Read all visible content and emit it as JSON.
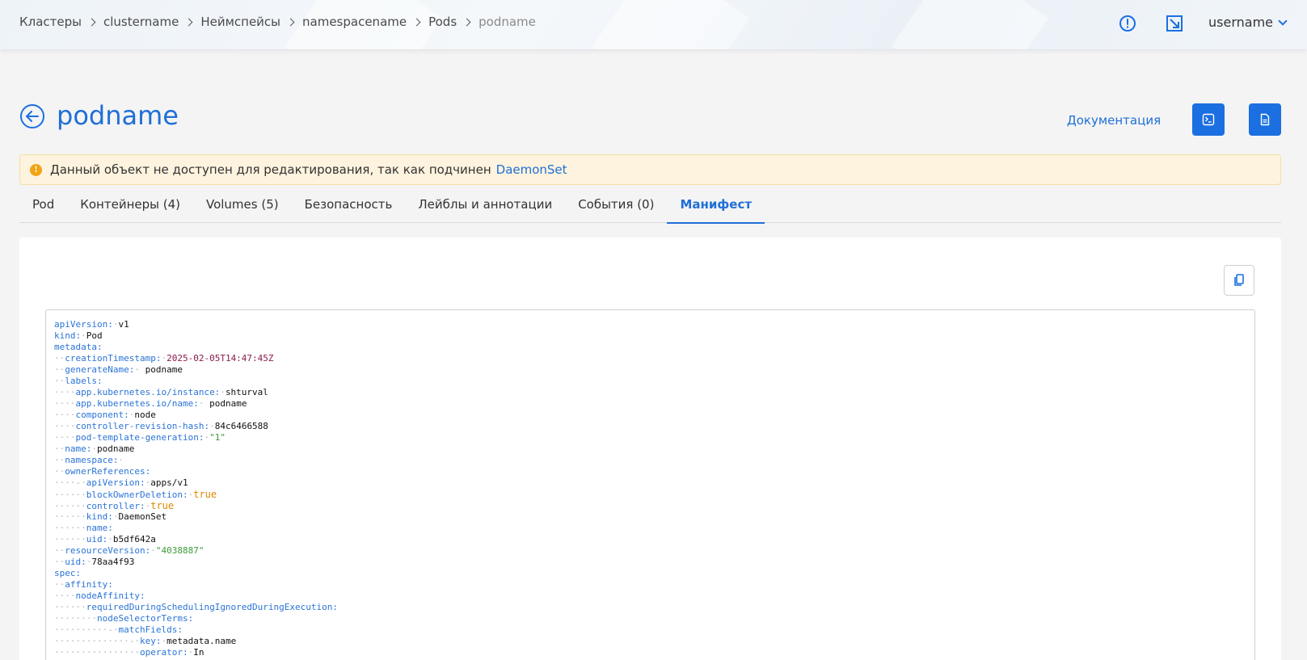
{
  "breadcrumb": [
    {
      "label": "Кластеры"
    },
    {
      "label": "clustername"
    },
    {
      "label": "Неймспейсы"
    },
    {
      "label": "namespacename"
    },
    {
      "label": "Pods"
    },
    {
      "label": "podname",
      "current": true
    }
  ],
  "header": {
    "user": "username"
  },
  "page": {
    "title": "podname",
    "doc_link": "Документация"
  },
  "alert": {
    "text": "Данный объект не доступен для редактирования, так как подчинен",
    "link": "DaemonSet"
  },
  "tabs": [
    {
      "label": "Pod"
    },
    {
      "label": "Контейнеры (4)"
    },
    {
      "label": "Volumes (5)"
    },
    {
      "label": "Безопасность"
    },
    {
      "label": "Лейблы и аннотации"
    },
    {
      "label": "События (0)"
    },
    {
      "label": "Манифест",
      "active": true
    }
  ],
  "manifest": [
    {
      "indent": "",
      "key": "apiVersion:",
      "sep": "·",
      "value": "v1"
    },
    {
      "indent": "",
      "key": "kind:",
      "sep": "·",
      "value": "Pod"
    },
    {
      "indent": "",
      "key": "metadata:",
      "sep": "",
      "value": ""
    },
    {
      "indent": "··",
      "key": "creationTimestamp:",
      "sep": "·",
      "value": "2025-02-05T14:47:45Z",
      "type": "date"
    },
    {
      "indent": "··",
      "key": "generateName:",
      "sep": "· ",
      "value": "podname"
    },
    {
      "indent": "··",
      "key": "labels:",
      "sep": "",
      "value": ""
    },
    {
      "indent": "····",
      "key": "app.kubernetes.io/instance:",
      "sep": "·",
      "value": "shturval"
    },
    {
      "indent": "····",
      "key": "app.kubernetes.io/name:",
      "sep": "· ",
      "value": "podname"
    },
    {
      "indent": "····",
      "key": "component:",
      "sep": "·",
      "value": "node"
    },
    {
      "indent": "····",
      "key": "controller-revision-hash:",
      "sep": "·",
      "value": "84c6466588"
    },
    {
      "indent": "····",
      "key": "pod-template-generation:",
      "sep": "·",
      "value": "\"1\"",
      "type": "str"
    },
    {
      "indent": "··",
      "key": "name:",
      "sep": "·",
      "value": "podname"
    },
    {
      "indent": "··",
      "key": "namespace:",
      "sep": "·",
      "value": ""
    },
    {
      "indent": "··",
      "key": "ownerReferences:",
      "sep": "",
      "value": ""
    },
    {
      "indent": "····-·",
      "key": "apiVersion:",
      "sep": "·",
      "value": "apps/v1"
    },
    {
      "indent": "······",
      "key": "blockOwnerDeletion:",
      "sep": "·",
      "value": "true",
      "type": "bool"
    },
    {
      "indent": "······",
      "key": "controller:",
      "sep": "·",
      "value": "true",
      "type": "bool"
    },
    {
      "indent": "······",
      "key": "kind:",
      "sep": "·",
      "value": "DaemonSet"
    },
    {
      "indent": "······",
      "key": "name:",
      "sep": "",
      "value": ""
    },
    {
      "indent": "······",
      "key": "uid:",
      "sep": "·",
      "value": "b5df642a"
    },
    {
      "indent": "··",
      "key": "resourceVersion:",
      "sep": "·",
      "value": "\"4038887\"",
      "type": "str"
    },
    {
      "indent": "··",
      "key": "uid:",
      "sep": "·",
      "value": "78aa4f93"
    },
    {
      "indent": "",
      "key": "spec:",
      "sep": "",
      "value": ""
    },
    {
      "indent": "··",
      "key": "affinity:",
      "sep": "",
      "value": ""
    },
    {
      "indent": "····",
      "key": "nodeAffinity:",
      "sep": "",
      "value": ""
    },
    {
      "indent": "······",
      "key": "requiredDuringSchedulingIgnoredDuringExecution:",
      "sep": "",
      "value": ""
    },
    {
      "indent": "········",
      "key": "nodeSelectorTerms:",
      "sep": "",
      "value": ""
    },
    {
      "indent": "··········-·",
      "key": "matchFields:",
      "sep": "",
      "value": ""
    },
    {
      "indent": "··············-·",
      "key": "key:",
      "sep": "·",
      "value": "metadata.name"
    },
    {
      "indent": "················",
      "key": "operator:",
      "sep": "·",
      "value": "In"
    }
  ],
  "colors": {
    "accent": "#1b6fe0",
    "alert_bg": "#fdf3de",
    "alert_icon": "#f0a516",
    "yaml_key": "#2a74d6",
    "yaml_date": "#8a1a4e",
    "yaml_bool": "#e08a00",
    "yaml_string": "#3b9b3b"
  },
  "icons": {
    "alert": "exclamation-circle-icon",
    "fullscreen": "expand-arrow-icon",
    "back": "arrow-left-circle-icon",
    "terminal": "terminal-icon",
    "file": "file-document-icon",
    "copy": "copy-icon"
  }
}
